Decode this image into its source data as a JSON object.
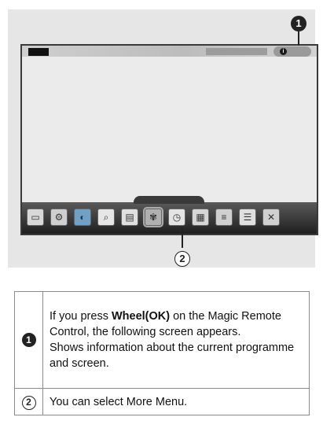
{
  "diagram": {
    "callouts": [
      "1",
      "2"
    ],
    "menu_icons": [
      {
        "name": "input-icon",
        "glyph": "▭",
        "color": "#d8d8d8"
      },
      {
        "name": "settings-icon",
        "glyph": "⚙",
        "color": "#cfcfcf"
      },
      {
        "name": "globe-icon",
        "glyph": "◐",
        "color": "#6fa0c8"
      },
      {
        "name": "search-icon",
        "glyph": "⌕",
        "color": "#e6e6e6"
      },
      {
        "name": "tv-guide-icon",
        "glyph": "▤",
        "color": "#e0e0e0"
      },
      {
        "name": "photo-icon",
        "glyph": "✾",
        "color": "#b0b0b0"
      },
      {
        "name": "clock-icon",
        "glyph": "◷",
        "color": "#e4e4e4"
      },
      {
        "name": "game-icon",
        "glyph": "▦",
        "color": "#d6d6d6"
      },
      {
        "name": "user-guide-icon",
        "glyph": "≡",
        "color": "#cfcfcf"
      },
      {
        "name": "list-icon",
        "glyph": "☰",
        "color": "#e0e0e0"
      },
      {
        "name": "close-icon",
        "glyph": "✕",
        "color": "#d0d0d0"
      }
    ]
  },
  "table": {
    "rows": [
      {
        "num": "1",
        "before": "If you press ",
        "bold": "Wheel(OK)",
        "after": " on the Magic Remote Control, the following screen appears.",
        "line2": "Shows information about the current programme and screen."
      },
      {
        "num": "2",
        "text": "You can select More Menu."
      }
    ]
  }
}
